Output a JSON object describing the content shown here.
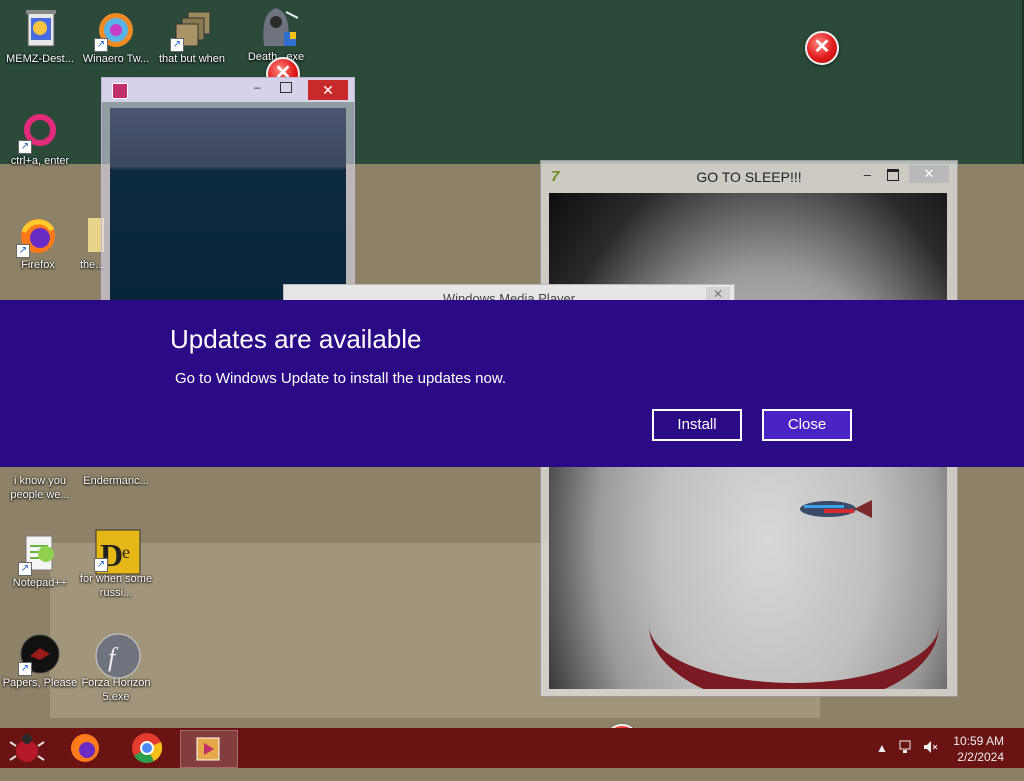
{
  "desktop": {
    "icons": [
      {
        "label": "MEMZ-Dest...",
        "icon": "recycle-bin-icon"
      },
      {
        "label": "Winaero Tw...",
        "icon": "winaero-tweaker-icon"
      },
      {
        "label": "that but when",
        "icon": "stacked-folders-icon"
      },
      {
        "label": "Death...exe",
        "icon": "grim-reaper-icon"
      },
      {
        "label": "ctrl+a, enter",
        "icon": "pink-ring-icon"
      },
      {
        "label": "Firefox",
        "icon": "firefox-icon"
      },
      {
        "label": "the...",
        "icon": "folder-icon"
      },
      {
        "label": "i know you people we...",
        "icon": "generic-app-icon"
      },
      {
        "label": "Endermanc...",
        "icon": "generic-app-icon"
      },
      {
        "label": "Notepad++",
        "icon": "notepad-plus-plus-icon"
      },
      {
        "label": "for when some russi...",
        "icon": "dependency-walker-icon"
      },
      {
        "label": "Papers, Please",
        "icon": "papers-please-icon"
      },
      {
        "label": "Forza Horizon 5.exe",
        "icon": "flash-player-icon"
      }
    ]
  },
  "windows": {
    "video": {
      "close_glyph": "✕"
    },
    "sleep": {
      "title": "GO TO SLEEP!!!",
      "close_glyph": "✕"
    },
    "wmp": {
      "title": "Windows Media Player"
    }
  },
  "update_banner": {
    "title": "Updates are available",
    "message": "Go to Windows Update to install the updates now.",
    "install_label": "Install",
    "close_label": "Close",
    "bg_color": "#2b0a85"
  },
  "taskbar": {
    "apps": [
      "malware-bug-icon",
      "firefox-icon",
      "chrome-icon",
      "media-player-icon"
    ],
    "time": "10:59 AM",
    "date": "2/2/2024",
    "bg_color": "#6a1313"
  }
}
